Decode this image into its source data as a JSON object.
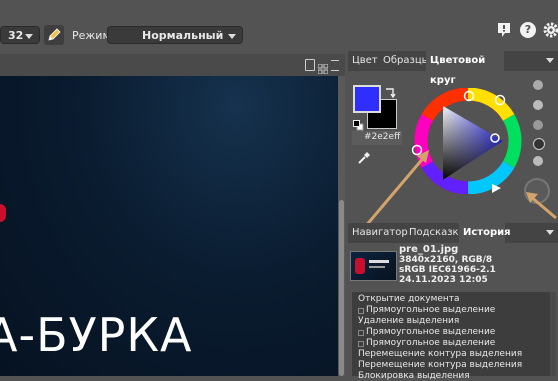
{
  "toolbar": {
    "size_value": "32",
    "mode_label": "Режим:",
    "mode_value": "Нормальный"
  },
  "panels": {
    "color_tabs": [
      "Цвет",
      "Образцы",
      "Цветовой круг"
    ],
    "hex_value": "#2e2eff",
    "foreground_color": "#2e2eff",
    "background_color": "#000000",
    "lower_tabs": [
      "Навигатор",
      "Подсказка",
      "История"
    ]
  },
  "history": {
    "file_name": "pre_01.jpg",
    "file_dims": "3840x2160, RGB/8",
    "file_profile": "sRGB IEC61966-2.1",
    "file_date": "24.11.2023 12:05",
    "items": [
      "Открытие документа",
      "Прямоугольное выделение",
      "Удаление выделения",
      "Прямоугольное выделение",
      "Прямоугольное выделение",
      "Перемещение контура выделения",
      "Перемещение контура выделения",
      "Блокировка выделения"
    ]
  },
  "document": {
    "headline": "А-БУРКА"
  }
}
